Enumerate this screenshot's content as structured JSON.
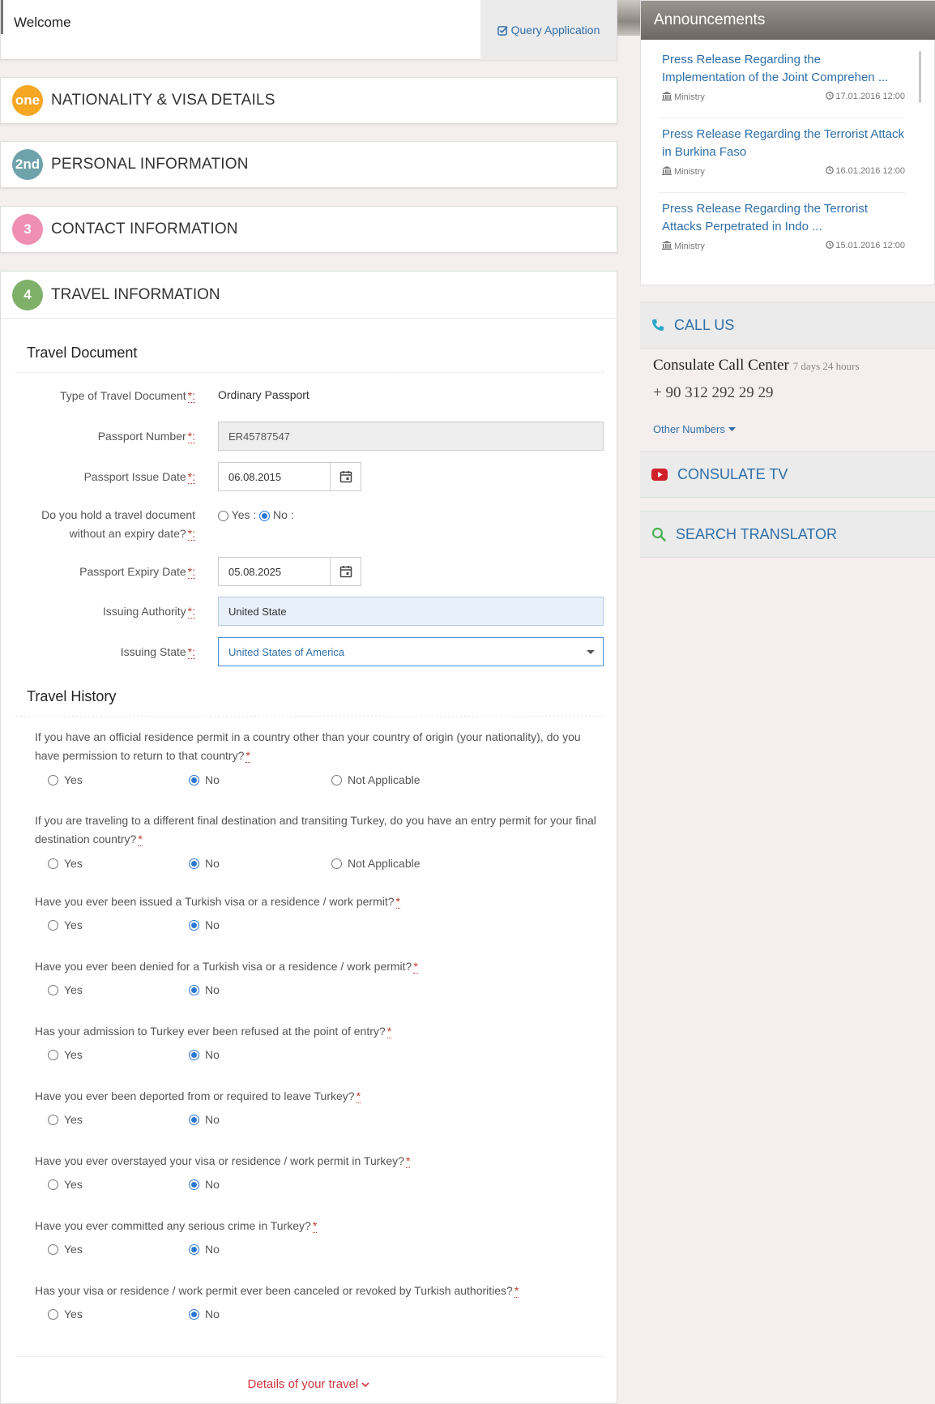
{
  "header": {
    "welcome": "Welcome",
    "query_application": "Query Application"
  },
  "steps": [
    {
      "badge": "one",
      "label": "NATIONALITY & VISA DETAILS",
      "color": "#f5a623"
    },
    {
      "badge": "2nd",
      "label": "PERSONAL INFORMATION",
      "color": "#6ea3ab"
    },
    {
      "badge": "3",
      "label": "CONTACT INFORMATION",
      "color": "#ef8fb3"
    },
    {
      "badge": "4",
      "label": "TRAVEL INFORMATION",
      "color": "#7fb069"
    }
  ],
  "travel_document": {
    "title": "Travel Document",
    "type_label": "Type of Travel Document",
    "type_value": "Ordinary Passport",
    "passport_number_label": "Passport Number",
    "passport_number": "ER45787547",
    "issue_date_label": "Passport Issue Date",
    "issue_date": "06.08.2015",
    "no_expiry_label": "Do you hold a travel document without an expiry date?",
    "no_expiry_yes": "Yes :",
    "no_expiry_no": "No :",
    "expiry_date_label": "Passport Expiry Date",
    "expiry_date": "05.08.2025",
    "issuing_authority_label": "Issuing Authority",
    "issuing_authority": "United State",
    "issuing_state_label": "Issuing State",
    "issuing_state": "United States of America",
    "required_mark": "*:"
  },
  "travel_history": {
    "title": "Travel History",
    "yes": "Yes",
    "no": "No",
    "not_applicable": "Not Applicable",
    "required_mark": "*",
    "questions": [
      "If you have an official residence permit in a country other than your country of origin (your nationality), do you have permission to return to that country?",
      "If you are traveling to a different final destination and transiting Turkey, do you have an entry permit for your final destination country?",
      "Have you ever been issued a Turkish visa or a residence / work permit?",
      "Have you ever been denied for a Turkish visa or a residence / work permit?",
      "Has your admission to Turkey ever been refused at the point of entry?",
      "Have you ever been deported from or required to leave Turkey?",
      "Have you ever overstayed your visa or residence / work permit in Turkey?",
      "Have you ever committed any serious crime in Turkey?",
      "Has your visa or residence / work permit ever been canceled or revoked by Turkish authorities?"
    ]
  },
  "details_link": "Details of your travel",
  "announcements": {
    "title": "Announcements",
    "items": [
      {
        "title": "Press Release Regarding the Implementation of the Joint Comprehen ...",
        "source": "Ministry",
        "date": "17.01.2016 12:00"
      },
      {
        "title": "Press Release Regarding the Terrorist Attack in Burkina Faso",
        "source": "Ministry",
        "date": "16.01.2016 12:00"
      },
      {
        "title": "Press Release Regarding the Terrorist Attacks Perpetrated in Indo ...",
        "source": "Ministry",
        "date": "15.01.2016 12:00"
      }
    ]
  },
  "call_us": {
    "label": "CALL US",
    "center": "Consulate Call Center",
    "hours": "7 days 24 hours",
    "phone": "+ 90 312 292 29 29",
    "other_numbers": "Other Numbers"
  },
  "consulate_tv": "CONSULATE TV",
  "search_translator": "SEARCH TRANSLATOR"
}
